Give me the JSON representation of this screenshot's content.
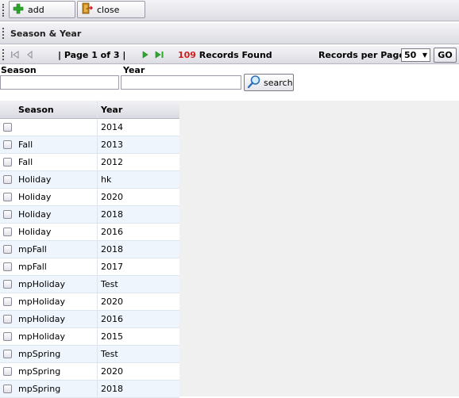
{
  "toolbar": {
    "add_label": "add",
    "close_label": "close"
  },
  "title": "Season & Year",
  "pager": {
    "page_text": "| Page 1 of 3 |",
    "records_count": "109",
    "records_text": " Records Found",
    "records_per_page_label": "Records per Page:",
    "records_per_page_value": "50",
    "go_label": "GO"
  },
  "filter": {
    "season_label": "Season",
    "year_label": "Year",
    "season_value": "",
    "year_value": "",
    "search_label": "search"
  },
  "grid": {
    "columns": [
      "Season",
      "Year"
    ],
    "rows": [
      {
        "season": "",
        "year": "2014"
      },
      {
        "season": "Fall",
        "year": "2013"
      },
      {
        "season": "Fall",
        "year": "2012"
      },
      {
        "season": "Holiday",
        "year": "hk"
      },
      {
        "season": "Holiday",
        "year": "2020"
      },
      {
        "season": "Holiday",
        "year": "2018"
      },
      {
        "season": "Holiday",
        "year": "2016"
      },
      {
        "season": "mpFall",
        "year": "2018"
      },
      {
        "season": "mpFall",
        "year": "2017"
      },
      {
        "season": "mpHoliday",
        "year": "Test"
      },
      {
        "season": "mpHoliday",
        "year": "2020"
      },
      {
        "season": "mpHoliday",
        "year": "2016"
      },
      {
        "season": "mpHoliday",
        "year": "2015"
      },
      {
        "season": "mpSpring",
        "year": "Test"
      },
      {
        "season": "mpSpring",
        "year": "2020"
      },
      {
        "season": "mpSpring",
        "year": "2018"
      }
    ]
  },
  "colors": {
    "accent_green": "#2fa82f",
    "record_count_red": "#cc2222",
    "row_alt": "#eef5fd"
  }
}
